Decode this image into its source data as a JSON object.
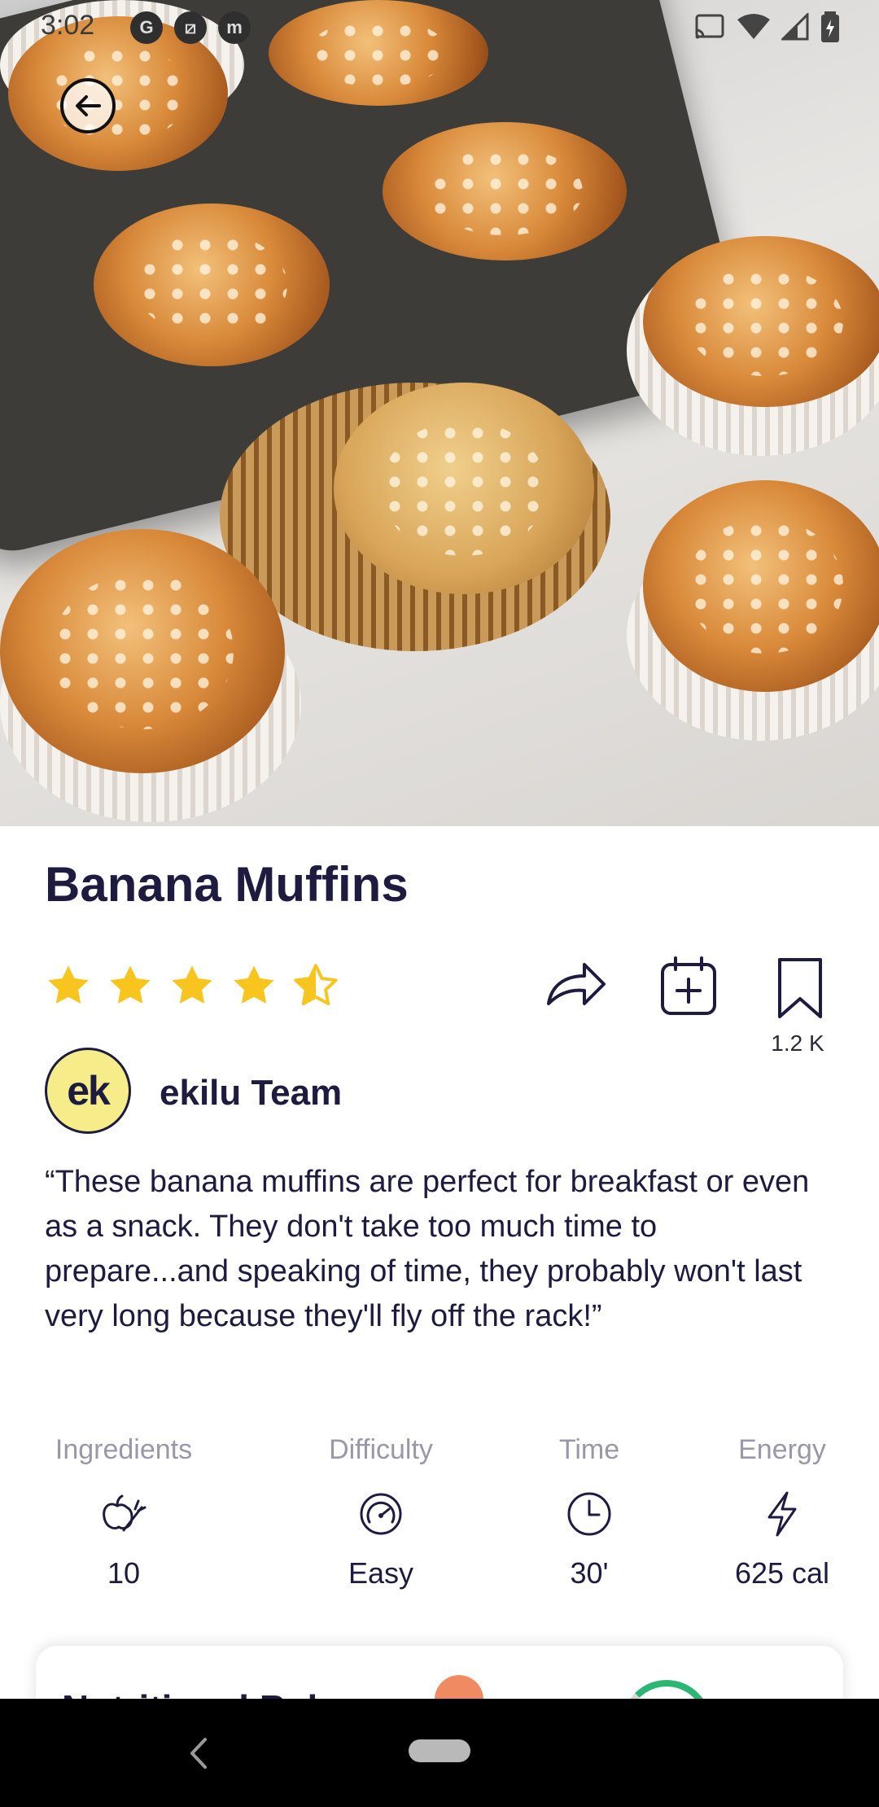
{
  "status_bar": {
    "time": "3:02",
    "left_icons": [
      "G",
      "⧄",
      "m"
    ]
  },
  "recipe": {
    "title": "Banana Muffins",
    "rating": 4.5,
    "rating_max": 5,
    "save_count": "1.2 K",
    "author": {
      "avatar_text": "ek",
      "name": "ekilu Team"
    },
    "description": "“These banana muffins are perfect for breakfast or even as a snack. They don't take too much time to prepare...and speaking of time, they probably won't last very long because they'll fly off the rack!”"
  },
  "stats": [
    {
      "label": "Ingredients",
      "value": "10",
      "icon": "vegetables-icon"
    },
    {
      "label": "Difficulty",
      "value": "Easy",
      "icon": "gauge-icon"
    },
    {
      "label": "Time",
      "value": "30'",
      "icon": "clock-icon"
    },
    {
      "label": "Energy",
      "value": "625 cal",
      "icon": "lightning-icon"
    }
  ],
  "nutrition": {
    "title": "Nutritional Bal"
  },
  "colors": {
    "primary_text": "#1d1b3f",
    "star": "#f7c51e",
    "muted": "#9a98a8"
  }
}
